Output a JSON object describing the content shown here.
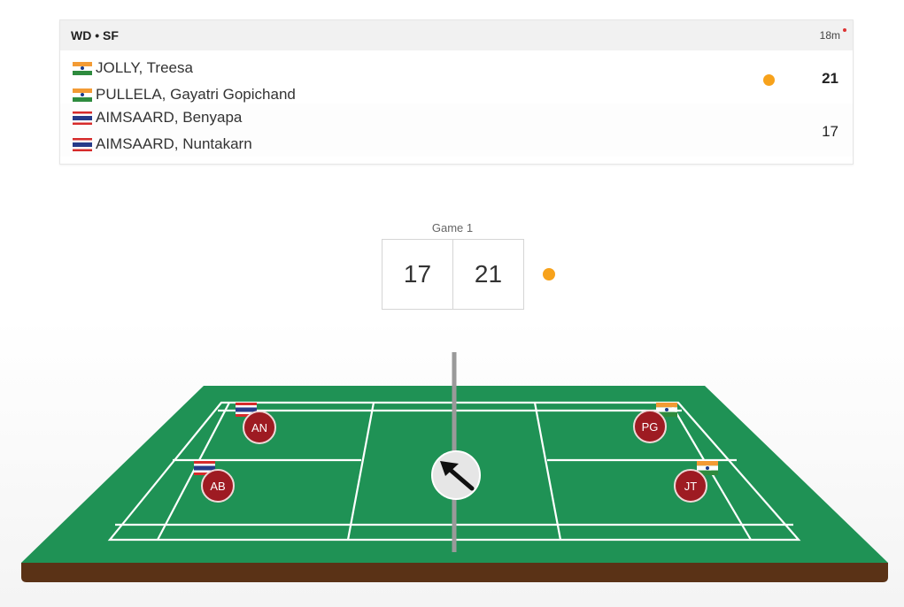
{
  "match": {
    "round": "WD • SF",
    "duration": "18m",
    "teams": [
      {
        "players": [
          {
            "name": "JOLLY, Treesa",
            "flag": "india-flag"
          },
          {
            "name": "PULLELA, Gayatri Gopichand",
            "flag": "india-flag"
          }
        ],
        "score": "21",
        "serving": true
      },
      {
        "players": [
          {
            "name": "AIMSAARD, Benyapa",
            "flag": "thailand-flag"
          },
          {
            "name": "AIMSAARD, Nuntakarn",
            "flag": "thailand-flag"
          }
        ],
        "score": "17",
        "serving": false
      }
    ]
  },
  "game": {
    "label": "Game 1",
    "left_score": "17",
    "right_score": "21"
  },
  "court": {
    "players": [
      {
        "initials": "AN",
        "flag": "thailand-flag"
      },
      {
        "initials": "AB",
        "flag": "thailand-flag"
      },
      {
        "initials": "PG",
        "flag": "india-flag"
      },
      {
        "initials": "JT",
        "flag": "india-flag"
      }
    ],
    "shuttle_icon": "arrow-up-left-icon"
  },
  "colors": {
    "court_green": "#1f9255",
    "court_base": "#5a3216",
    "serve_indicator": "#f7a21b",
    "player_marker": "#9e1b22"
  }
}
